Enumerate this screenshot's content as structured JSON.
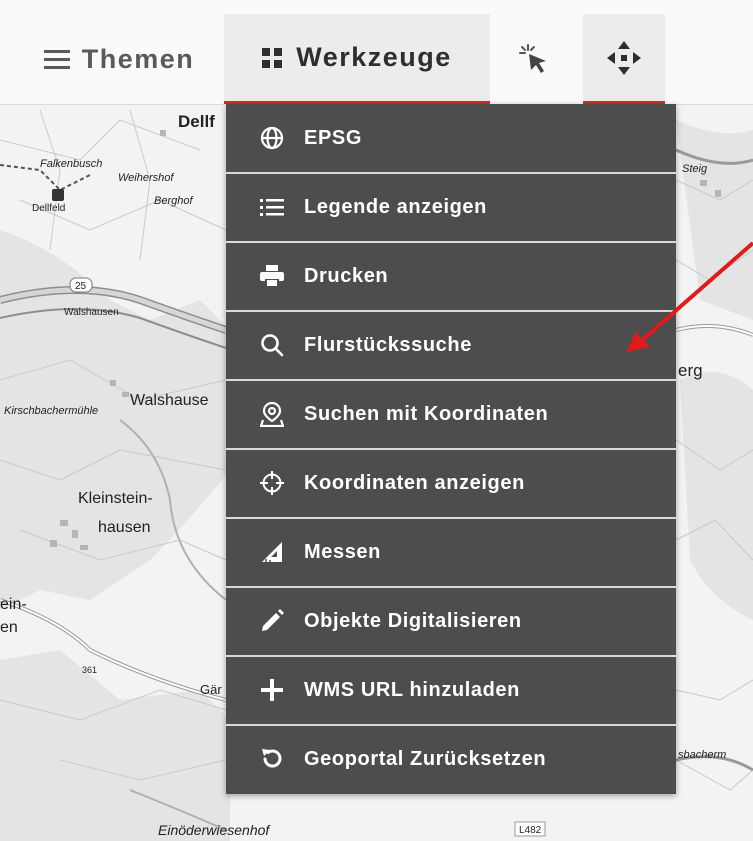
{
  "toolbar": {
    "themen_label": "Themen",
    "werkzeuge_label": "Werkzeuge",
    "select_icon": "pointer-select-icon",
    "pan_icon": "move-arrows-icon",
    "active_color": "#d62a2a"
  },
  "menu": {
    "background": "#4d4d4d",
    "items": [
      {
        "label": "EPSG",
        "icon": "globe-icon"
      },
      {
        "label": "Legende anzeigen",
        "icon": "list-icon"
      },
      {
        "label": "Drucken",
        "icon": "printer-icon"
      },
      {
        "label": "Flurstückssuche",
        "icon": "search-icon"
      },
      {
        "label": "Suchen mit Koordinaten",
        "icon": "map-pin-icon"
      },
      {
        "label": "Koordinaten anzeigen",
        "icon": "crosshair-icon"
      },
      {
        "label": "Messen",
        "icon": "ruler-triangle-icon"
      },
      {
        "label": "Objekte Digitalisieren",
        "icon": "pencil-icon"
      },
      {
        "label": "WMS URL hinzuladen",
        "icon": "plus-icon"
      },
      {
        "label": "Geoportal Zurücksetzen",
        "icon": "reset-icon"
      }
    ]
  },
  "map": {
    "labels": {
      "dellf": "Dellf",
      "falkenbusch": "Falkenbusch",
      "weihershof": "Weihershof",
      "berghof": "Berghof",
      "dellfeld": "Dellfeld",
      "walshausen_small": "Walshausen",
      "road_25": "25",
      "walshausen": "Walshause",
      "kirschbachermuehle": "Kirschbachermühle",
      "kleinstein": "Kleinstein-",
      "hausen": "hausen",
      "ein": "ein-",
      "en": "en",
      "road_361": "361",
      "gar": "Gär",
      "einoederwiesenhof": "Einöderwiesenhof",
      "road_l482": "L482",
      "steig": "Steig",
      "erg": "erg",
      "sbacherm": "sbacherm"
    }
  }
}
